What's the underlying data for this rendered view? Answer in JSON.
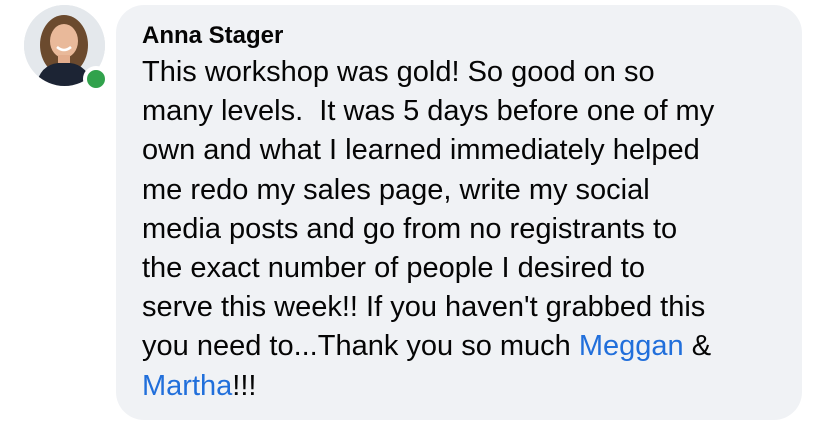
{
  "comment": {
    "author": "Anna Stager",
    "lines": [
      "This workshop was gold! So good on so",
      "many levels.  It was 5 days before one of my",
      "own and what I learned immediately helped",
      "me redo my sales page, write my social",
      "media posts and go from no registrants to",
      "the exact number of people I desired to",
      "serve this week!! If you haven't grabbed this"
    ],
    "line8_text": "you need to...Thank you so much ",
    "mention1": "Meggan",
    "ampersand": " &",
    "mention2": "Martha",
    "ending": "!!!"
  },
  "colors": {
    "bubble": "#f0f2f5",
    "mention": "#216fdb",
    "online": "#31a24c"
  }
}
